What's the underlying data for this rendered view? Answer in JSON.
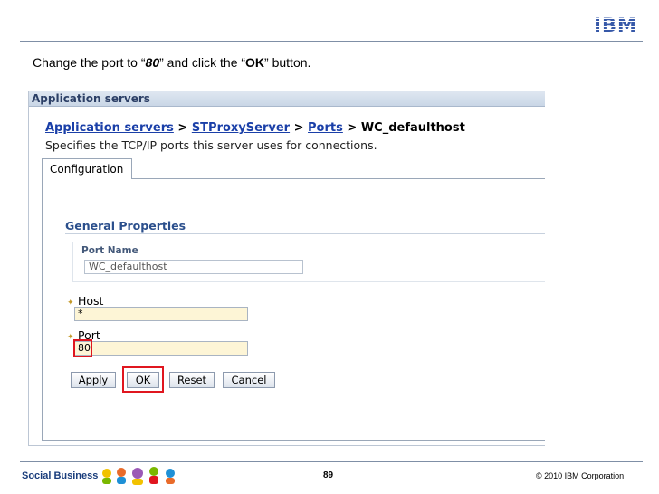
{
  "slide": {
    "logo": "IBM",
    "instruction": {
      "prefix": "Change the port to “",
      "port_value": "80",
      "middle": "” and click the “",
      "button_name": "OK",
      "suffix": "” button."
    },
    "footer": {
      "left": "Social Business",
      "page": "89",
      "right": "© 2010 IBM Corporation"
    }
  },
  "console": {
    "window_title": "Application servers",
    "breadcrumb": {
      "link1": "Application servers",
      "sep1": " > ",
      "link2": "STProxyServer",
      "sep2": " > ",
      "link3": "Ports",
      "sep3": " > ",
      "current": "WC_defaulthost"
    },
    "description": "Specifies the TCP/IP ports this server uses for connections.",
    "tab_label": "Configuration",
    "section_title": "General Properties",
    "port_name": {
      "label": "Port Name",
      "value": "WC_defaulthost"
    },
    "host": {
      "label": "Host",
      "value": "*"
    },
    "port": {
      "label": "Port",
      "value": "80"
    },
    "required_marker": "✦",
    "buttons": {
      "apply": "Apply",
      "ok": "OK",
      "reset": "Reset",
      "cancel": "Cancel"
    }
  },
  "colors": {
    "link_blue": "#1a3fa8",
    "section_title": "#2b4f8c",
    "input_fill": "#fdf5d6",
    "highlight_red": "#e0161f",
    "ibm_blue": "#3658a8"
  },
  "icons": {
    "required": "required-field-icon",
    "footer_art": "social-people-icon"
  }
}
